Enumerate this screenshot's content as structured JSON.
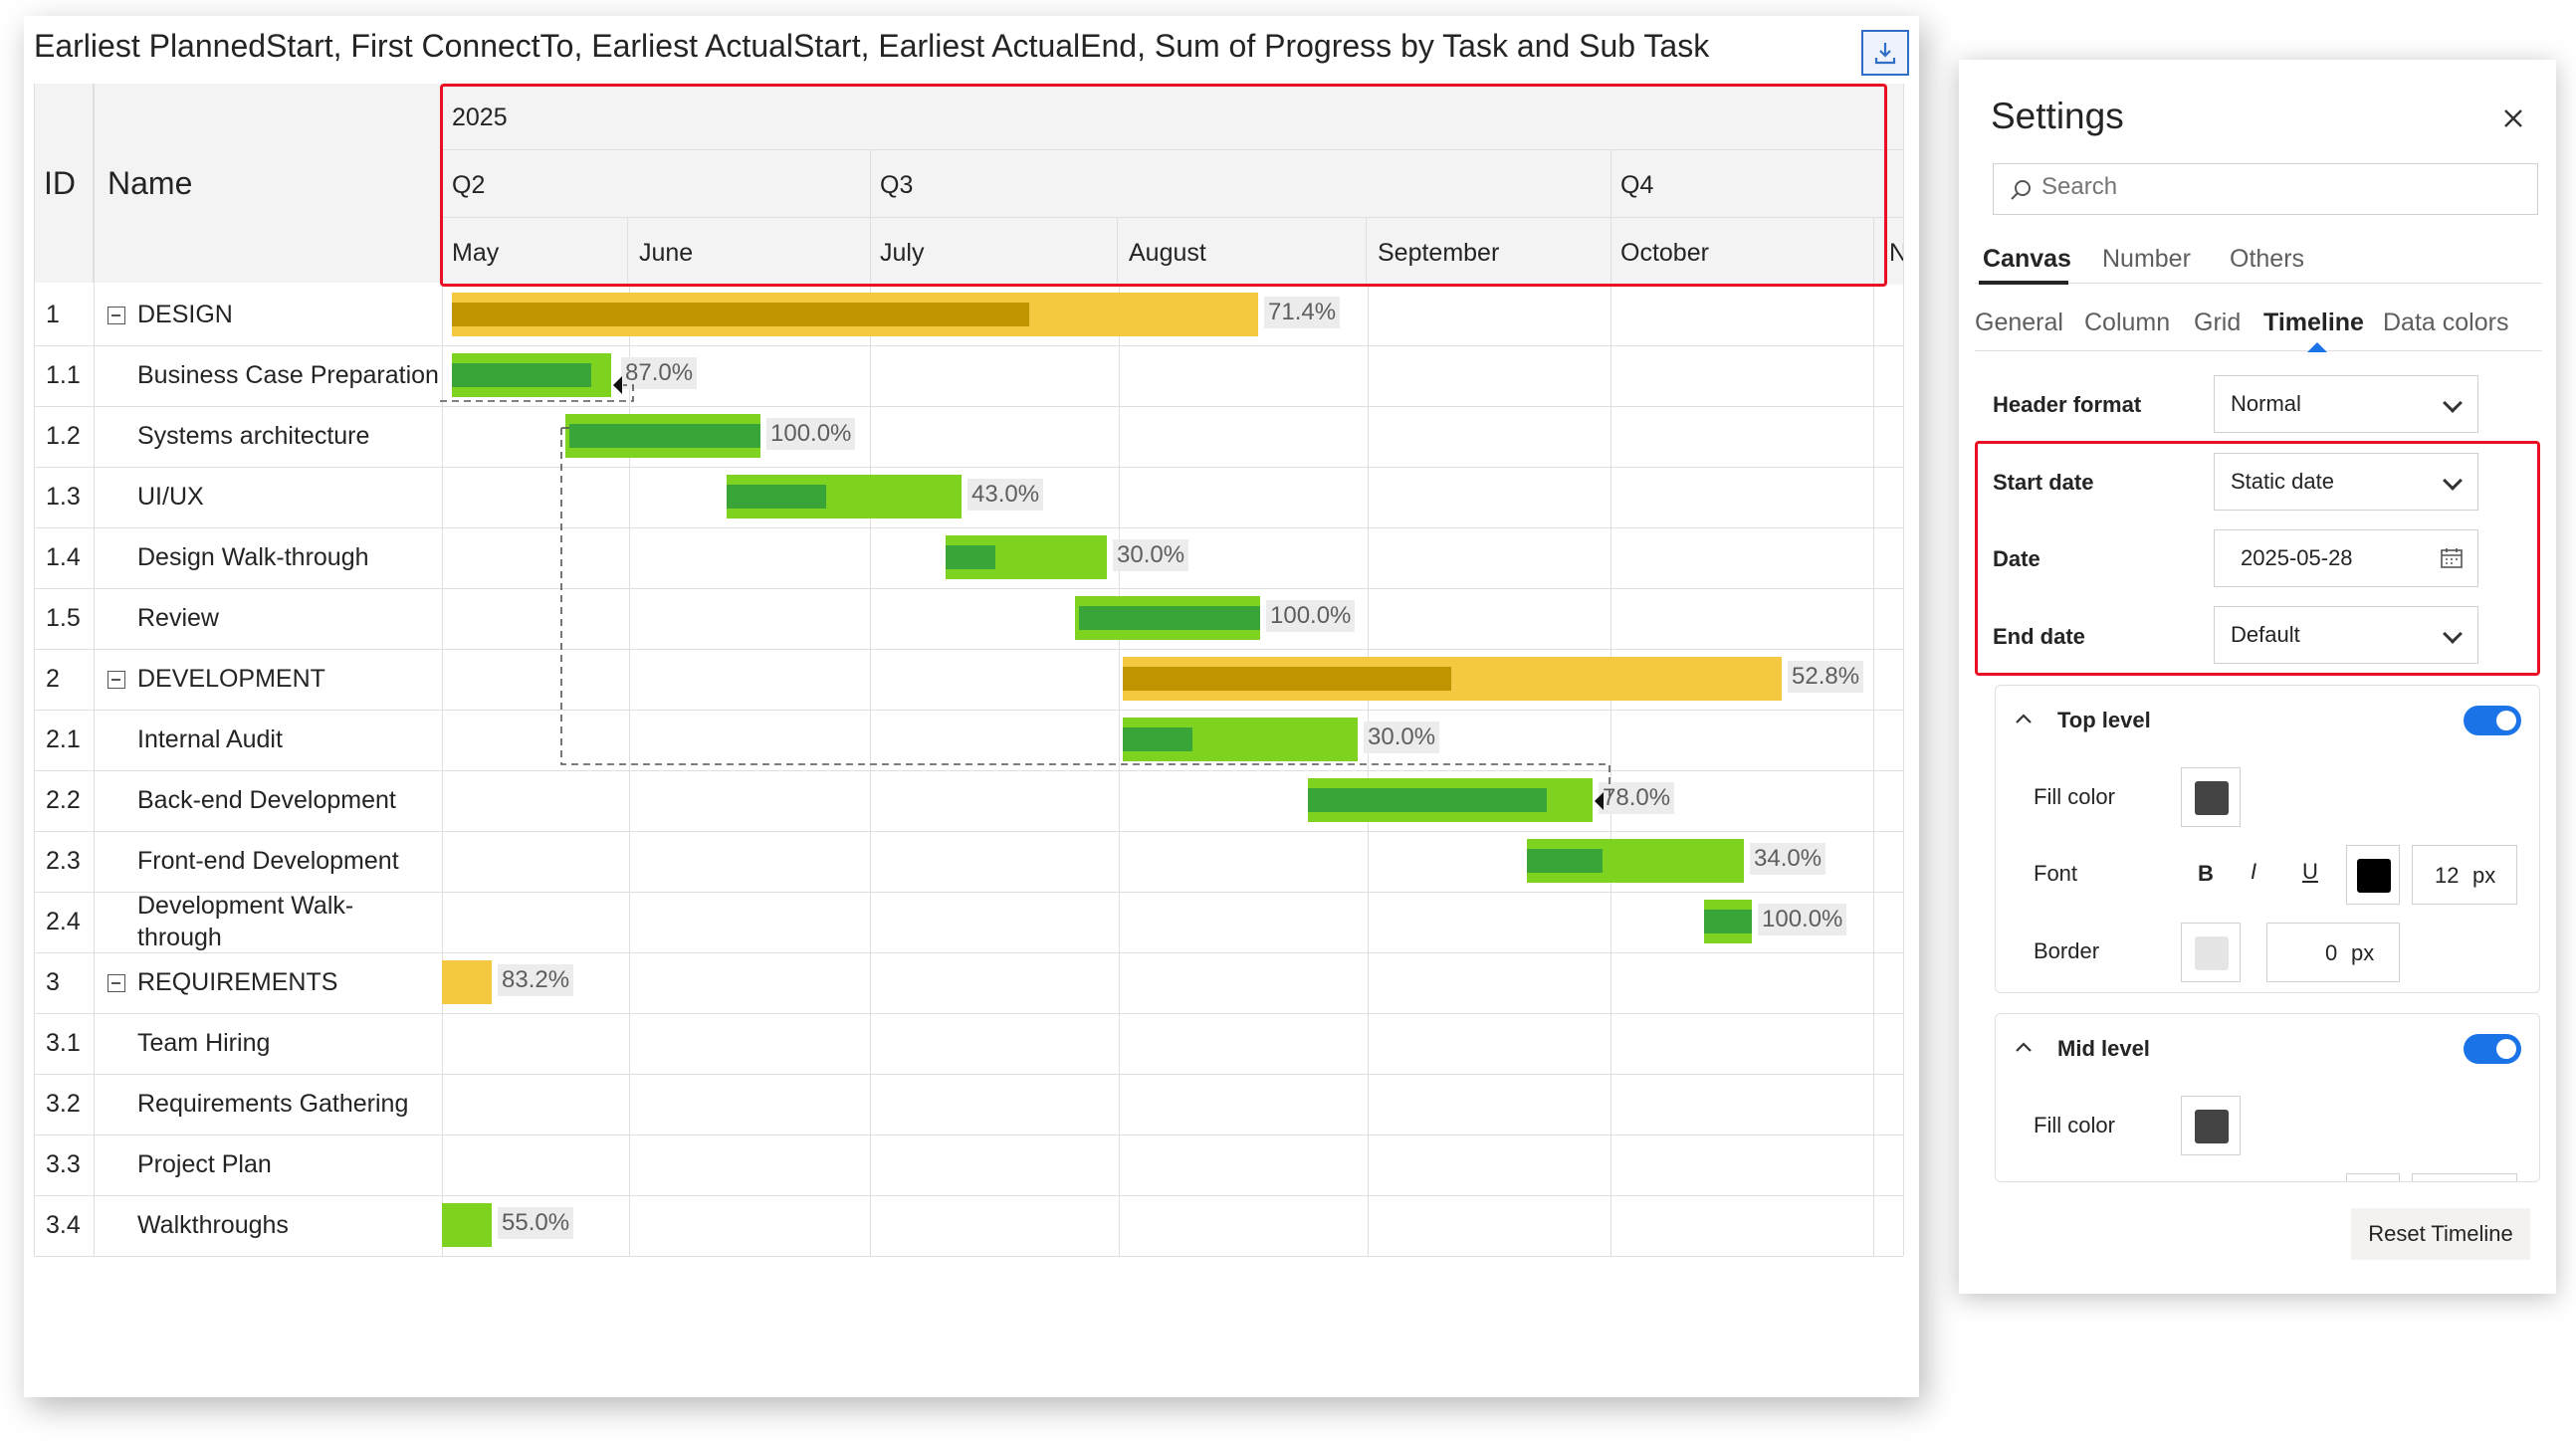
{
  "visual": {
    "title": "Earliest PlannedStart, First ConnectTo, Earliest ActualStart, Earliest ActualEnd, Sum of Progress by Task and Sub Task",
    "export_icon": "export-icon",
    "headers": {
      "id": "ID",
      "name": "Name"
    },
    "timeline": {
      "year": "2025",
      "quarters": [
        "Q2",
        "Q3",
        "Q4"
      ],
      "months": [
        "May",
        "June",
        "July",
        "August",
        "September",
        "October",
        "No"
      ]
    },
    "rows": [
      {
        "id": "1",
        "name": "DESIGN",
        "summary": true,
        "progress": "71.4%"
      },
      {
        "id": "1.1",
        "name": "Business Case Preparation",
        "summary": false,
        "progress": "87.0%"
      },
      {
        "id": "1.2",
        "name": "Systems architecture",
        "summary": false,
        "progress": "100.0%"
      },
      {
        "id": "1.3",
        "name": "UI/UX",
        "summary": false,
        "progress": "43.0%"
      },
      {
        "id": "1.4",
        "name": "Design Walk-through",
        "summary": false,
        "progress": "30.0%"
      },
      {
        "id": "1.5",
        "name": "Review",
        "summary": false,
        "progress": "100.0%"
      },
      {
        "id": "2",
        "name": "DEVELOPMENT",
        "summary": true,
        "progress": "52.8%"
      },
      {
        "id": "2.1",
        "name": "Internal Audit",
        "summary": false,
        "progress": "30.0%"
      },
      {
        "id": "2.2",
        "name": "Back-end Development",
        "summary": false,
        "progress": "78.0%"
      },
      {
        "id": "2.3",
        "name": "Front-end Development",
        "summary": false,
        "progress": "34.0%"
      },
      {
        "id": "2.4",
        "name": "Development Walk-through",
        "summary": false,
        "progress": "100.0%"
      },
      {
        "id": "3",
        "name": "REQUIREMENTS",
        "summary": true,
        "progress": "83.2%"
      },
      {
        "id": "3.1",
        "name": "Team Hiring",
        "summary": false,
        "progress": ""
      },
      {
        "id": "3.2",
        "name": "Requirements Gathering",
        "summary": false,
        "progress": ""
      },
      {
        "id": "3.3",
        "name": "Project Plan",
        "summary": false,
        "progress": ""
      },
      {
        "id": "3.4",
        "name": "Walkthroughs",
        "summary": false,
        "progress": "55.0%"
      }
    ],
    "colors": {
      "summary_planned": "#f5c842",
      "summary_progress": "#bf9400",
      "task_planned": "#7ed321",
      "task_progress": "#39a539",
      "highlight": "#e81123"
    }
  },
  "settings": {
    "title": "Settings",
    "close_icon": "close-icon",
    "search": {
      "placeholder": "Search",
      "icon": "search-icon"
    },
    "top_tabs": [
      "Canvas",
      "Number",
      "Others"
    ],
    "active_top_tab": "Canvas",
    "sub_tabs": [
      "General",
      "Column",
      "Grid",
      "Timeline",
      "Data colors"
    ],
    "active_sub_tab": "Timeline",
    "header_format": {
      "label": "Header format",
      "value": "Normal"
    },
    "start_date": {
      "label": "Start date",
      "value": "Static date"
    },
    "date": {
      "label": "Date",
      "value": "2025-05-28",
      "icon": "calendar-icon"
    },
    "end_date": {
      "label": "End date",
      "value": "Default"
    },
    "top_level": {
      "label": "Top level",
      "enabled": true,
      "fill_color_label": "Fill color",
      "fill_color": "#444444",
      "font_label": "Font",
      "bold": "B",
      "italic": "I",
      "underline": "U",
      "font_color": "#000000",
      "font_size": "12",
      "font_unit": "px",
      "border_label": "Border",
      "border_color": "#e5e5e5",
      "border_width": "0",
      "border_unit": "px"
    },
    "mid_level": {
      "label": "Mid level",
      "enabled": true,
      "fill_color_label": "Fill color",
      "fill_color": "#444444"
    },
    "reset_button": "Reset Timeline",
    "accent": "#1b73e8"
  }
}
